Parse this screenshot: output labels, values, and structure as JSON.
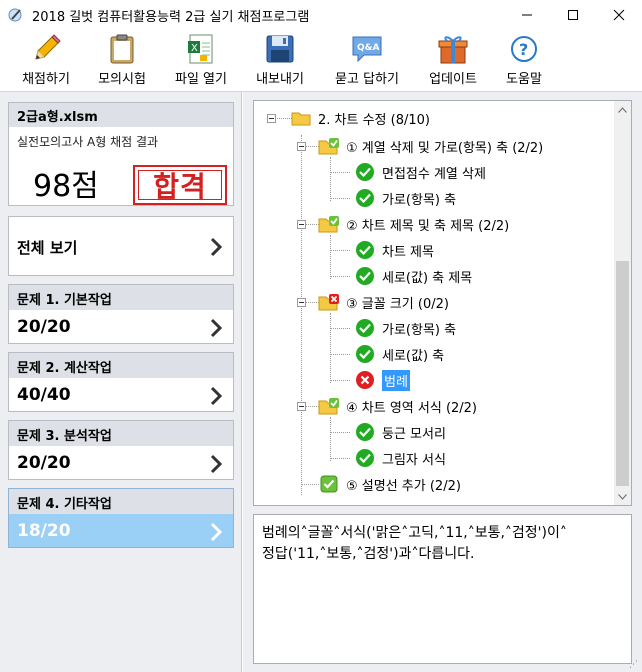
{
  "window": {
    "title": "2018 길벗 컴퓨터활용능력 2급 실기 채점프로그램"
  },
  "toolbar": {
    "grade_label": "채점하기",
    "mock_label": "모의시험",
    "open_label": "파일 열기",
    "export_label": "내보내기",
    "qa_label": "묻고 답하기",
    "update_label": "업데이트",
    "help_label": "도움말",
    "qa_icon_text": "Q&A"
  },
  "summary": {
    "file": "2급a형.xlsm",
    "desc": "실전모의고사 A형 채점 결과",
    "score": "98점",
    "stamp": "합격"
  },
  "overview": {
    "label": "전체 보기"
  },
  "questions": [
    {
      "title": "문제 1. 기본작업",
      "score": "20/20"
    },
    {
      "title": "문제 2. 계산작업",
      "score": "40/40"
    },
    {
      "title": "문제 3. 분석작업",
      "score": "20/20"
    },
    {
      "title": "문제 4. 기타작업",
      "score": "18/20"
    }
  ],
  "tree": {
    "root": "2. 차트 수정 (8/10)",
    "g1": "① 계열 삭제 및 가로(항목) 축 (2/2)",
    "g1a": "면접점수 계열 삭제",
    "g1b": "가로(항목) 축",
    "g2": "② 차트 제목 및 축 제목 (2/2)",
    "g2a": "차트 제목",
    "g2b": "세로(값) 축 제목",
    "g3": "③ 글꼴 크기 (0/2)",
    "g3a": "가로(항목) 축",
    "g3b": "세로(값) 축",
    "g3c": "범례",
    "g4": "④ 차트 영역 서식 (2/2)",
    "g4a": "둥근 모서리",
    "g4b": "그림자 서식",
    "g5": "⑤ 설명선 추가 (2/2)"
  },
  "message": {
    "line1": "범례의˄글꼴˄서식('맑은˄고딕,˄11,˄보통,˄검정')이˄",
    "line2": "정답('11,˄보통,˄검정')과˄다릅니다."
  },
  "colors": {
    "accent": "#3399ff",
    "active_card": "#9ad0f5",
    "stamp": "#d32020",
    "ok": "#22aa22",
    "fail": "#e02020"
  }
}
